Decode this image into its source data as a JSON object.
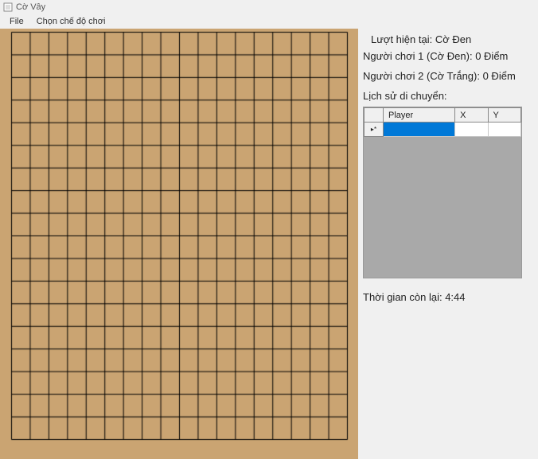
{
  "window": {
    "title": "Cờ Vây"
  },
  "menu": {
    "items": [
      "File",
      "Chọn chế độ chơi"
    ]
  },
  "game": {
    "turn_label": "Lượt hiện tại: Cờ Đen",
    "player1": "Người chơi 1 (Cờ Đen): 0 Điểm",
    "player2": "Người chơi 2 (Cờ Trắng): 0 Điểm",
    "history_title": "Lịch sử di chuyển:",
    "timer": "Thời gian còn lại: 4:44",
    "board_size": 19
  },
  "history_grid": {
    "columns": [
      "",
      "Player",
      "X",
      "Y"
    ],
    "row_marker": "▸*",
    "rows": [
      {
        "selected": true,
        "player": "",
        "x": "",
        "y": ""
      }
    ]
  }
}
